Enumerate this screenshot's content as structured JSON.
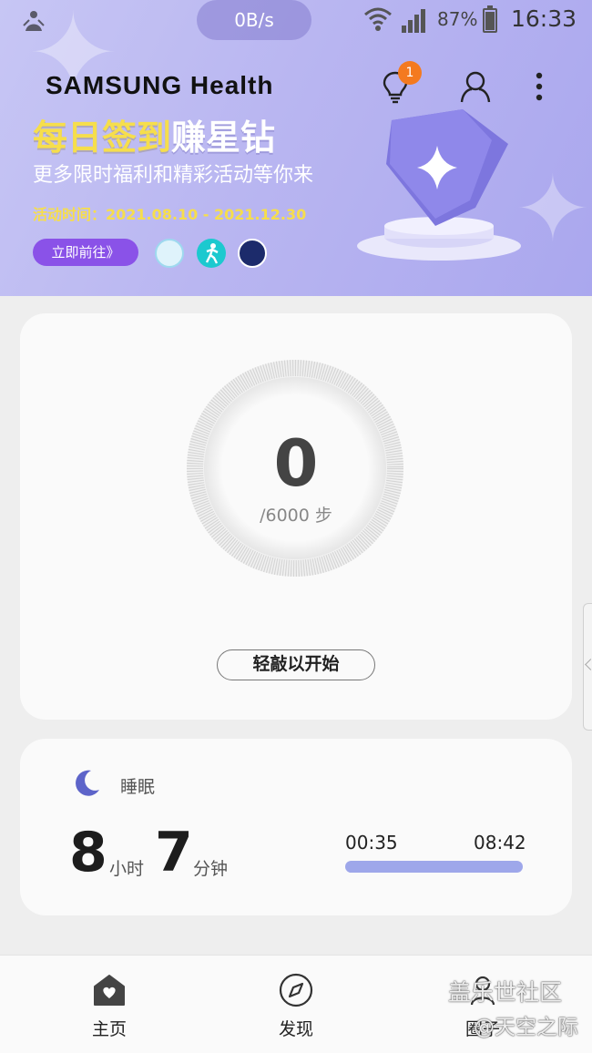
{
  "status_bar": {
    "net_speed": "0B/s",
    "battery_percent": "87%",
    "battery_level": 0.87,
    "time": "16:33"
  },
  "header": {
    "brand": "SAMSUNG Health",
    "notification_count": "1"
  },
  "promo": {
    "title_highlight": "每日签到",
    "title_rest": "赚星钻",
    "subtitle": "更多限时福利和精彩活动等你来",
    "period": "活动时间：2021.08.10 - 2021.12.30",
    "cta": "立即前往》"
  },
  "steps": {
    "count": "0",
    "goal": "/6000 步",
    "progress": 0,
    "start_button": "轻敲以开始"
  },
  "sleep": {
    "label": "睡眠",
    "hours": "8",
    "hours_unit": "小时",
    "minutes": "7",
    "minutes_unit": "分钟",
    "start_time": "00:35",
    "end_time": "08:42",
    "bar_color": "#9ea7ea"
  },
  "bottom_nav": {
    "home": "主页",
    "discover": "发现",
    "circle": "圈子"
  },
  "watermark": {
    "line1": "盖乐世社区",
    "line2": "@天空之际"
  },
  "colors": {
    "banner": "#b9b6f1",
    "accent_purple": "#8a52e8",
    "badge": "#f47a1f",
    "title_yellow": "#f6de4c"
  }
}
